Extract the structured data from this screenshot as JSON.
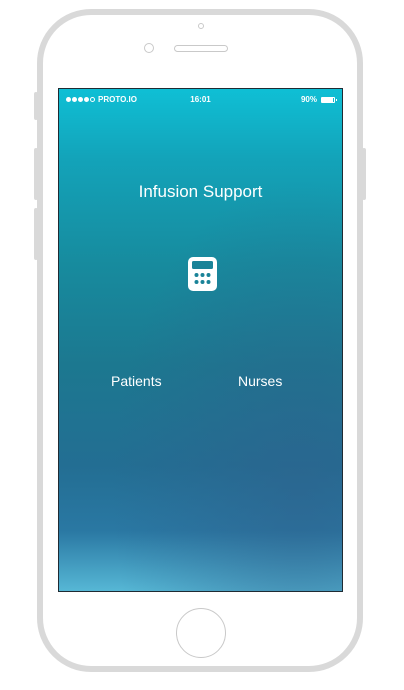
{
  "status_bar": {
    "carrier": "PROTO.IO",
    "signal_bars_filled": 4,
    "signal_bars_total": 5,
    "time": "16:01",
    "battery_label": "90%",
    "battery_level": 0.9
  },
  "app": {
    "title": "Infusion Support",
    "icon": "calculator-icon",
    "menu": [
      {
        "label": "Patients"
      },
      {
        "label": "Nurses"
      }
    ]
  },
  "colors": {
    "device_frame": "#d9d9d9",
    "screen_gradient_top": "#0fbfd5",
    "screen_gradient_mid": "#1c7890",
    "screen_gradient_bottom": "#56b7d5",
    "text": "#ffffff"
  }
}
